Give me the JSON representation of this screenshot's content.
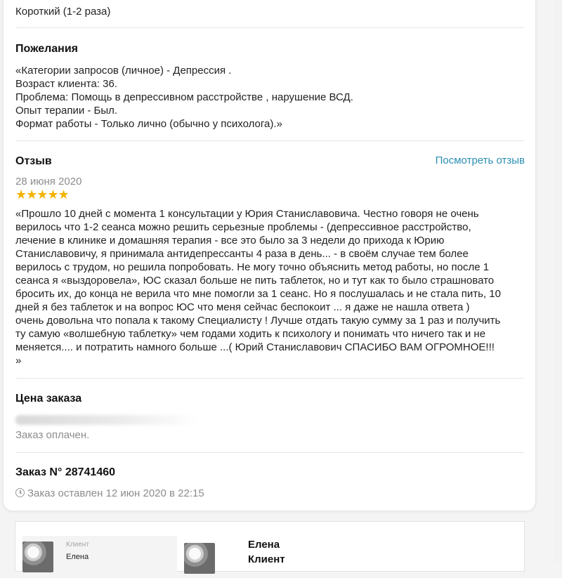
{
  "duration_value": "Короткий (1-2 раза)",
  "wishes": {
    "heading": "Пожелания",
    "lines": [
      "«Категории запросов (личное) - Депрессия .",
      "Возраст клиента: 36.",
      "Проблема: Помощь в депрессивном расстройстве , нарушение ВСД.",
      "Опыт терапии - Был.",
      "Формат работы - Только лично (обычно у психолога).»"
    ]
  },
  "review": {
    "heading": "Отзыв",
    "link": "Посмотреть отзыв",
    "date": "28 июня 2020",
    "rating": 4.5,
    "stars_text": "★★★★★",
    "lines": [
      "«Прошло 10 дней с момента 1 консультации у Юрия Станиславовича. Честно говоря не очень",
      "верилось что 1-2 сеанса можно решить серьезные проблемы - (депрессивное расстройство,",
      "лечение в клинике и домашняя терапия - все это было за 3 недели до прихода к Юрию",
      "Станиславовичу, я принимала антидепрессанты 4 раза в день... - в своём случае тем более",
      "верилось с трудом, но решила попробовать. Не могу точно объяснить метод работы, но после 1",
      "сеанса я «выздоровела», ЮС сказал больше не пить таблеток, но и тут как то было страшновато",
      "бросить их, до конца не верила что мне помогли за 1 сеанс. Но я послушалась и не стала пить, 10",
      "дней я без таблеток и на вопрос ЮС что меня сейчас беспокоит ... я даже не нашла ответа )",
      "очень довольна что попала к такому Специалисту ! Лучше отдать такую сумму за 1 раз и получить",
      "ту самую «волшебную таблетку» чем годами ходить к психологу и понимать что ничего так и не",
      "меняется.... и потратить намного больше ...( Юрий Станиславович СПАСИБО ВАМ ОГРОМНОЕ!!!",
      "»"
    ]
  },
  "price": {
    "heading": "Цена заказа",
    "status": "Заказ оплачен."
  },
  "order": {
    "heading": "Заказ N° 28741460",
    "created": "Заказ оставлен 12 июн 2020 в 22:15"
  },
  "bottom": {
    "thumb_label": "Клиент",
    "thumb_name": "Елена",
    "name": "Елена",
    "role": "Клиент"
  },
  "colors": {
    "link": "#2c8fb4",
    "star": "#f2b400",
    "muted": "#8c8c8c"
  }
}
